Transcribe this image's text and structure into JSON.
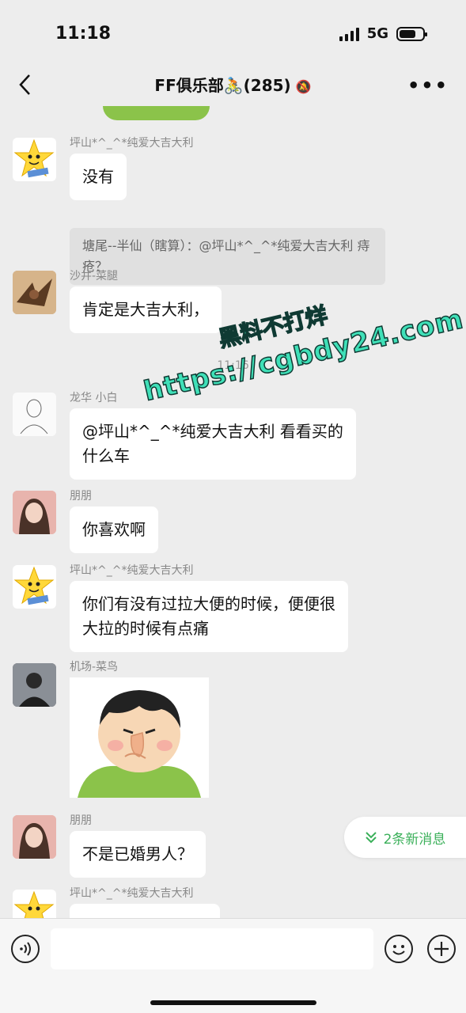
{
  "status": {
    "time": "11:18",
    "network": "5G"
  },
  "nav": {
    "title": "FF俱乐部🚴(285)"
  },
  "messages": [
    {
      "sender": "坪山*^_^*纯爱大吉大利",
      "text": "没有",
      "quote": "塘尾--半仙（瞎算）：@坪山*^_^*纯爱大吉大利 痔疮？"
    },
    {
      "sender": "沙井-菜腿",
      "text": "肯定是大吉大利，"
    },
    {
      "time_divider": "11:16"
    },
    {
      "sender": "龙华 小白",
      "text_line1": "@坪山*^_^*纯爱大吉大利 看看买的",
      "text_line2": "什么车"
    },
    {
      "sender": "朋朋",
      "text": "你喜欢啊"
    },
    {
      "sender": "坪山*^_^*纯爱大吉大利",
      "text_line1": "你们有没有过拉大便的时候，便便很",
      "text_line2": "大拉的时候有点痛"
    },
    {
      "sender": "机场-菜鸟",
      "sticker": "nose-picking-boy"
    },
    {
      "sender": "朋朋",
      "text": "不是已婚男人？"
    },
    {
      "sender": "坪山*^_^*纯爱大吉大利"
    }
  ],
  "new_messages_badge": "2条新消息",
  "watermark": {
    "line1": "黑料不打烊",
    "line2": "https://cgbdy24.com"
  },
  "input": {
    "placeholder": ""
  },
  "icons": {
    "back": "chevron-left-icon",
    "mute": "bell-slash-icon",
    "more": "more-dots-icon",
    "voice": "voice-icon",
    "emoji": "emoji-icon",
    "plus": "plus-icon"
  },
  "colors": {
    "background": "#ededed",
    "bubble": "#ffffff",
    "accent": "#3bb05a",
    "watermark": "#3fe0b8"
  }
}
